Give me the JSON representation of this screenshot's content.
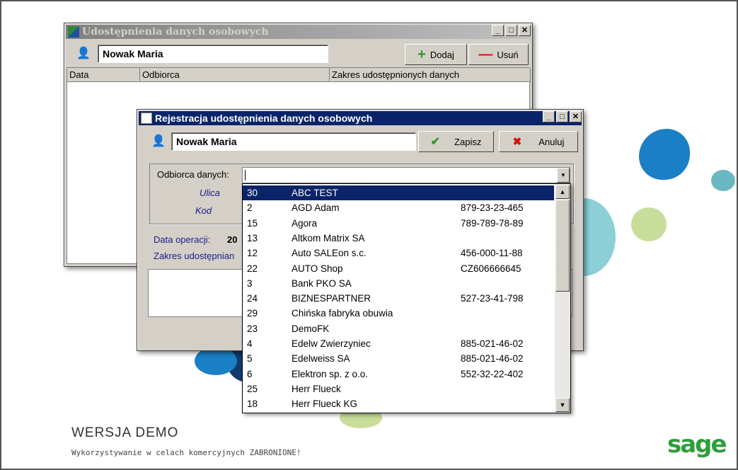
{
  "back_window": {
    "title": "Udostępnienia danych osobowych",
    "person": "Nowak Maria",
    "add_label": "Dodaj",
    "remove_label": "Usuń",
    "columns": [
      "Data",
      "Odbiorca",
      "Zakres udostępnionych danych"
    ]
  },
  "front_window": {
    "title": "Rejestracja udostępnienia danych osobowych",
    "person": "Nowak Maria",
    "save_label": "Zapisz",
    "cancel_label": "Anuluj",
    "recipient_label": "Odbiorca danych:",
    "recipient_value": "",
    "street_label": "Ulica",
    "code_label": "Kod",
    "date_label": "Data operacji:",
    "date_value": "20",
    "scope_label": "Zakres udostępnian"
  },
  "dropdown": {
    "rows": [
      {
        "id": "30",
        "name": "ABC TEST",
        "nip": ""
      },
      {
        "id": "2",
        "name": "AGD Adam",
        "nip": "879-23-23-465"
      },
      {
        "id": "15",
        "name": "Agora",
        "nip": "789-789-78-89"
      },
      {
        "id": "13",
        "name": "Altkom Matrix SA",
        "nip": ""
      },
      {
        "id": "12",
        "name": "Auto SALEon s.c.",
        "nip": "456-000-11-88"
      },
      {
        "id": "22",
        "name": "AUTO Shop",
        "nip": "CZ606666645"
      },
      {
        "id": "3",
        "name": "Bank PKO SA",
        "nip": ""
      },
      {
        "id": "24",
        "name": "BIZNESPARTNER",
        "nip": "527-23-41-798"
      },
      {
        "id": "29",
        "name": "Chińska fabryka obuwia",
        "nip": ""
      },
      {
        "id": "23",
        "name": "DemoFK",
        "nip": ""
      },
      {
        "id": "4",
        "name": "Edelw Zwierzyniec",
        "nip": "885-021-46-02"
      },
      {
        "id": "5",
        "name": "Edelweiss SA",
        "nip": "885-021-46-02"
      },
      {
        "id": "6",
        "name": "Elektron sp. z o.o.",
        "nip": "552-32-22-402"
      },
      {
        "id": "25",
        "name": "Herr Flueck",
        "nip": ""
      },
      {
        "id": "18",
        "name": "Herr Flueck KG",
        "nip": ""
      }
    ]
  },
  "watermark": {
    "title": "WERSJA DEMO",
    "subtitle": "Wykorzystywanie w celach komercyjnych ZABRONIONE!",
    "logo": "sage"
  },
  "colors": {
    "active_title": "#0a246a",
    "inactive_title": "#808080",
    "logo_green": "#2e9e3a"
  }
}
